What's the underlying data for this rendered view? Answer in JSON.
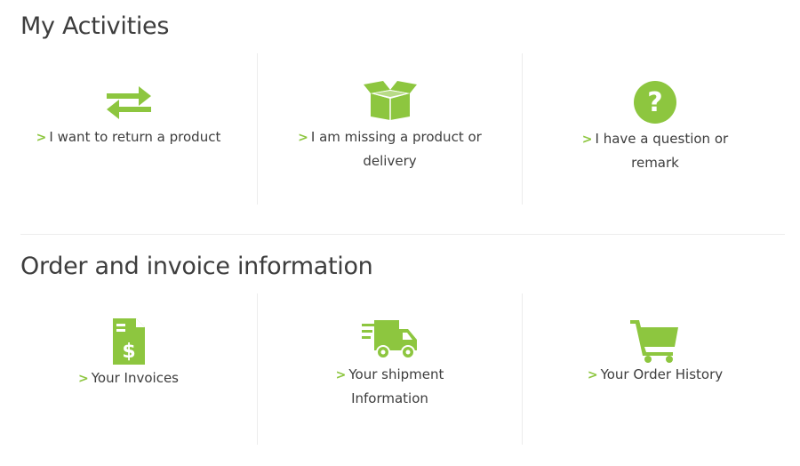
{
  "accent_color": "#8dc63f",
  "activities": {
    "title": "My Activities",
    "tiles": [
      {
        "icon": "exchange-arrows-icon",
        "label": "I want to return a product"
      },
      {
        "icon": "open-box-icon",
        "label": "I am missing a product or delivery",
        "line1": "I am missing a product or",
        "line2": "delivery"
      },
      {
        "icon": "question-circle-icon",
        "label": "I have a question or remark",
        "line1": "I have a question or",
        "line2": "remark"
      }
    ]
  },
  "orders": {
    "title": "Order and invoice information",
    "tiles": [
      {
        "icon": "invoice-dollar-icon",
        "label": "Your Invoices"
      },
      {
        "icon": "fast-truck-icon",
        "label": "Your shipment Information",
        "line1": "Your shipment",
        "line2": "Information"
      },
      {
        "icon": "shopping-cart-icon",
        "label": "Your Order History"
      }
    ]
  },
  "chevron": ">"
}
